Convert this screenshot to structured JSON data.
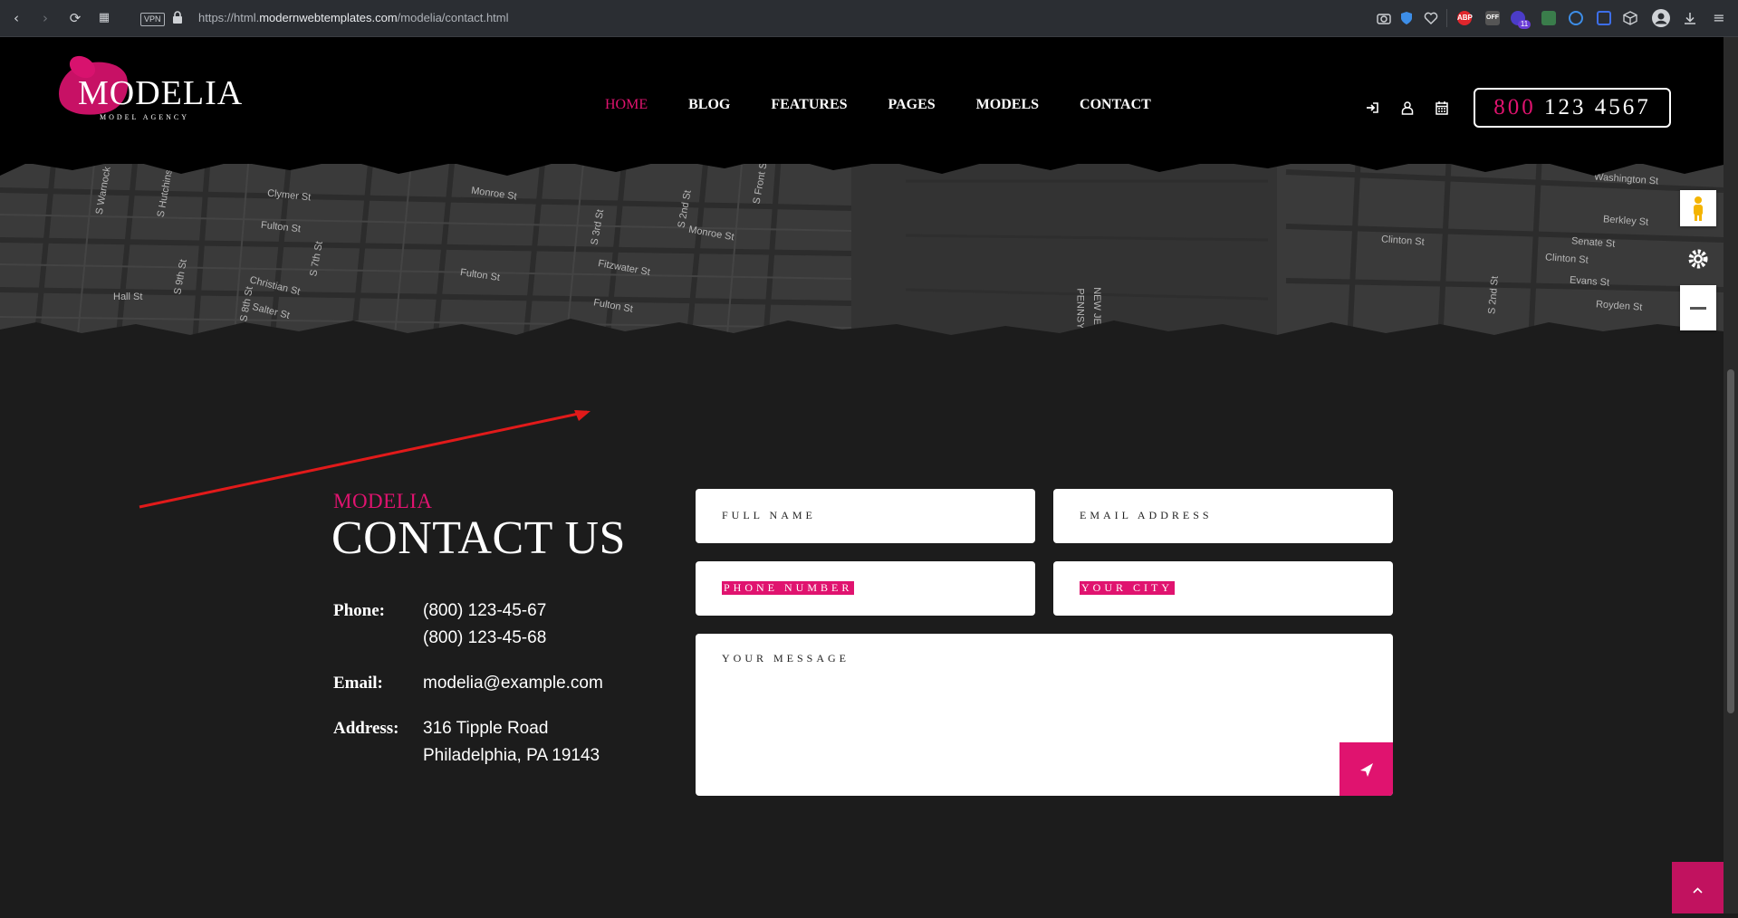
{
  "browser": {
    "url_prefix": "https://html.",
    "url_domain": "modernwebtemplates.com",
    "url_path": "/modelia/contact.html",
    "vpn_label": "VPN",
    "ext_abp": "ABP",
    "ext_off": "OFF",
    "ext_badge_count": "11"
  },
  "header": {
    "brand": "MODELIA",
    "tagline": "MODEL AGENCY",
    "nav": [
      "HOME",
      "BLOG",
      "FEATURES",
      "PAGES",
      "MODELS",
      "CONTACT"
    ],
    "active_nav": "HOME",
    "phone_prefix": "800",
    "phone_rest": "123 4567",
    "accent_color": "#e0136f"
  },
  "map": {
    "labels": [
      "S Warnock St",
      "S Hutchinson St",
      "Clymer St",
      "Fulton St",
      "Christian St",
      "Hall St",
      "S 9th St",
      "S 8th St",
      "Salter St",
      "S 7th St",
      "Monroe St",
      "Fulton St",
      "S 3rd St",
      "S 2nd St",
      "Monroe St",
      "Fitzwater St",
      "Fulton St",
      "S Front St",
      "Clinton St",
      "Washington St",
      "Berkley St",
      "Senate St",
      "Clinton St",
      "Evans St",
      "Royden St",
      "S 2nd St",
      "NEW JE",
      "PENNSY"
    ]
  },
  "contact": {
    "kicker": "MODELIA",
    "title": "CONTACT US",
    "phone_label": "Phone:",
    "phone_1": "(800) 123-45-67",
    "phone_2": "(800) 123-45-68",
    "email_label": "Email:",
    "email": "modelia@example.com",
    "address_label": "Address:",
    "address_1": "316 Tipple Road",
    "address_2": "Philadelphia, PA 19143"
  },
  "form": {
    "full_name": "FULL NAME",
    "email": "EMAIL ADDRESS",
    "phone": "PHONE NUMBER",
    "city": "YOUR CITY",
    "message": "YOUR MESSAGE"
  }
}
